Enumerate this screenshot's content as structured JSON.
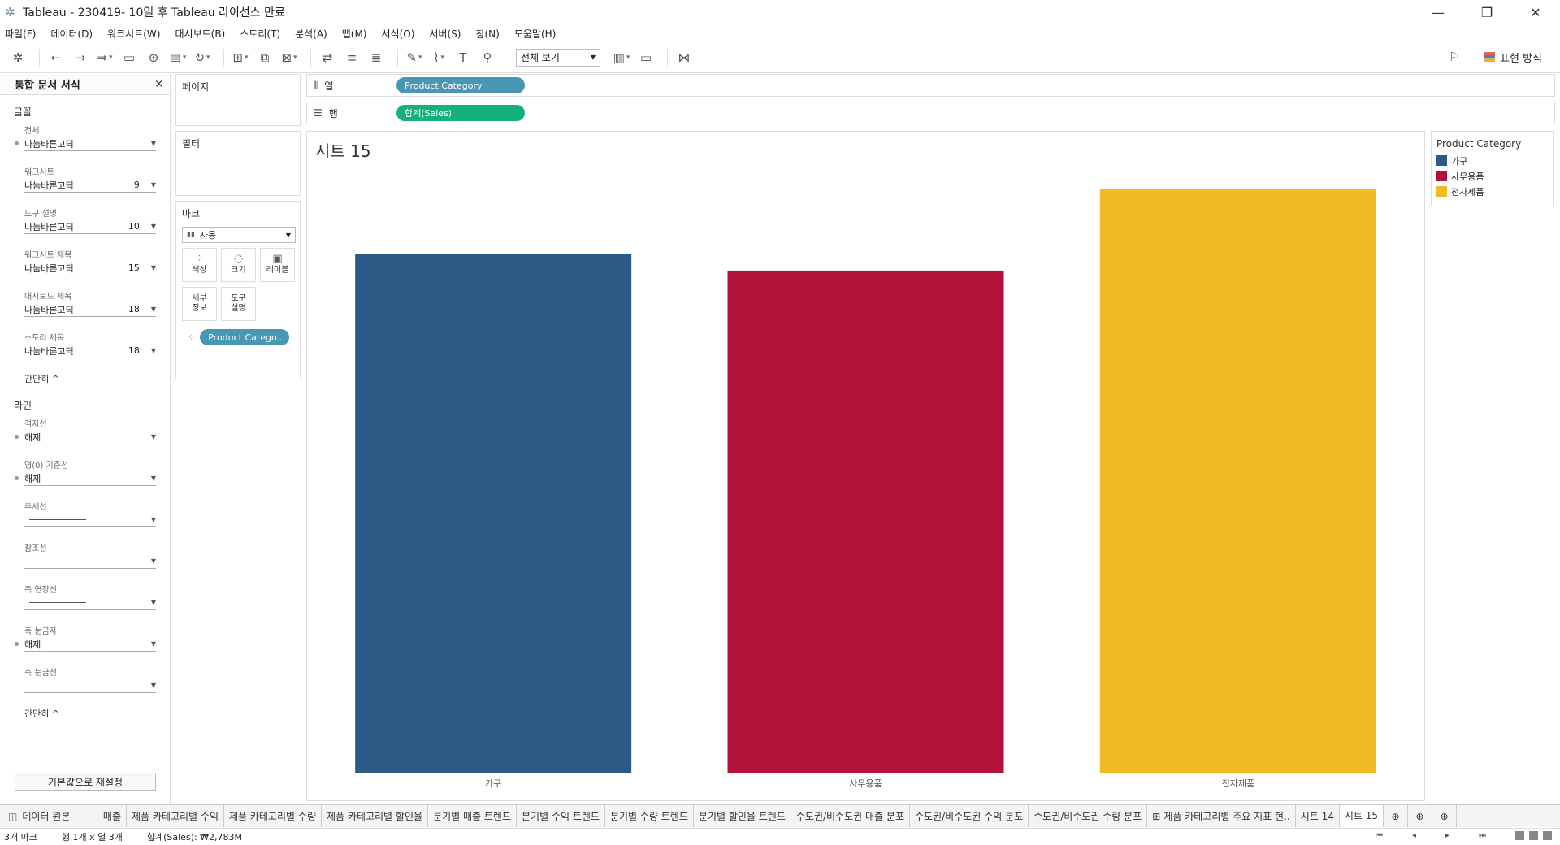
{
  "window": {
    "title": "Tableau - 230419- 10일 후 Tableau 라이선스 만료"
  },
  "menu": [
    "파일(F)",
    "데이터(D)",
    "워크시트(W)",
    "대시보드(B)",
    "스토리(T)",
    "분석(A)",
    "맵(M)",
    "서식(O)",
    "서버(S)",
    "창(N)",
    "도움말(H)"
  ],
  "toolbar": {
    "view_select": "전체 보기",
    "show_me": "표현 방식"
  },
  "format_pane": {
    "title": "통합 문서 서식",
    "font_section": "글꼴",
    "font_items": [
      {
        "label": "전체",
        "font": "나눔바른고딕",
        "size": ""
      },
      {
        "label": "워크시트",
        "font": "나눔바른고딕",
        "size": "9"
      },
      {
        "label": "도구 설명",
        "font": "나눔바른고딕",
        "size": "10"
      },
      {
        "label": "워크시트 제목",
        "font": "나눔바른고딕",
        "size": "15"
      },
      {
        "label": "대시보드 제목",
        "font": "나눔바른고딕",
        "size": "18"
      },
      {
        "label": "스토리 제목",
        "font": "나눔바른고딕",
        "size": "18"
      }
    ],
    "collapse_label": "간단히 ^",
    "line_section": "라인",
    "line_items": [
      {
        "label": "격자선",
        "value": "해제"
      },
      {
        "label": "영(0) 기준선",
        "value": "해제"
      },
      {
        "label": "추세선",
        "value": ""
      },
      {
        "label": "참조선",
        "value": ""
      },
      {
        "label": "축 연장선",
        "value": ""
      },
      {
        "label": "축 눈금자",
        "value": "해제"
      },
      {
        "label": "축 눈금선",
        "value": ""
      }
    ],
    "collapse_label2": "간단히 ^",
    "reset_button": "기본값으로 재설정"
  },
  "cards": {
    "pages": "페이지",
    "filters": "필터",
    "marks": "마크",
    "mark_type": "자동",
    "mark_buttons": [
      {
        "icon": "color-icon",
        "label": "색상"
      },
      {
        "icon": "size-icon",
        "label": "크기"
      },
      {
        "icon": "label-icon",
        "label": "레이블"
      },
      {
        "icon": "detail-icon",
        "label": "세부\n정보"
      },
      {
        "icon": "tooltip-icon",
        "label": "도구\n설명"
      }
    ],
    "color_pill": "Product Catego.."
  },
  "shelves": {
    "columns_label": "열",
    "columns_pill": "Product Category",
    "rows_label": "행",
    "rows_pill": "합계(Sales)"
  },
  "view": {
    "title": "시트 15"
  },
  "legend": {
    "title": "Product Category",
    "items": [
      {
        "label": "가구",
        "color": "#2b5a86"
      },
      {
        "label": "사무용품",
        "color": "#b0123a"
      },
      {
        "label": "전자제품",
        "color": "#f0bb26"
      }
    ]
  },
  "chart_data": {
    "type": "bar",
    "categories": [
      "가구",
      "사무용품",
      "전자제품"
    ],
    "values": [
      0.889,
      0.861,
      1.0
    ],
    "value_note": "",
    "colors": [
      "#2b5a86",
      "#b0123a",
      "#f0bb26"
    ],
    "title": "시트 15",
    "xlabel": "",
    "ylabel": "",
    "grid": false
  },
  "tabs": [
    "데이터 원본",
    "매출",
    "제품 카테고리별 수익",
    "제품 카테고리별 수량",
    "제품 카테고리별 할인율",
    "분기별 매출 트렌드",
    "분기별 수익 트렌드",
    "분기별 수량 트렌드",
    "분기별 할인율 트렌드",
    "수도권/비수도권 매출 분포",
    "수도권/비수도권 수익 분포",
    "수도권/비수도권 수량 분포",
    "제품 카테고리별 주요 지표 현..",
    "시트 14",
    "시트 15"
  ],
  "active_tab": "시트 15",
  "status": {
    "marks": "3개 마크",
    "rows_cols": "행 1개 x 열 3개",
    "sum": "합계(Sales): ₩2,783M"
  },
  "colors": {
    "col_pill": "#4a96b5",
    "row_pill": "#14b07d",
    "color_pill": "#4a96b5"
  }
}
